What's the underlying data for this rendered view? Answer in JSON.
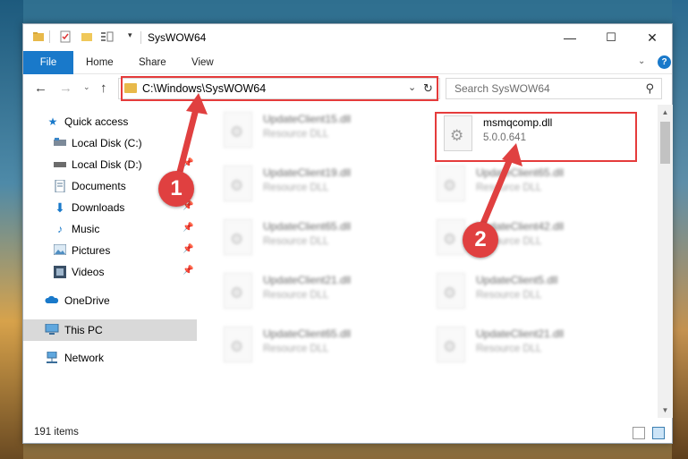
{
  "window": {
    "title": "SysWOW64",
    "controls": {
      "minimize": "—",
      "maximize": "☐",
      "close": "✕"
    }
  },
  "ribbon": {
    "file_tab": "File",
    "tabs": [
      "Home",
      "Share",
      "View"
    ]
  },
  "address_bar": {
    "path": "C:\\Windows\\SysWOW64",
    "search_placeholder": "Search SysWOW64"
  },
  "nav_pane": {
    "items": [
      {
        "label": "Quick access",
        "icon": "star-icon"
      },
      {
        "label": "Local Disk (C:)",
        "icon": "drive-icon"
      },
      {
        "label": "Local Disk (D:)",
        "icon": "drive-icon"
      },
      {
        "label": "Documents",
        "icon": "documents-icon"
      },
      {
        "label": "Downloads",
        "icon": "download-icon"
      },
      {
        "label": "Music",
        "icon": "music-icon"
      },
      {
        "label": "Pictures",
        "icon": "pictures-icon"
      },
      {
        "label": "Videos",
        "icon": "videos-icon"
      },
      {
        "label": "OneDrive",
        "icon": "cloud-icon"
      },
      {
        "label": "This PC",
        "icon": "computer-icon"
      },
      {
        "label": "Network",
        "icon": "network-icon"
      }
    ]
  },
  "files": {
    "highlighted": {
      "name": "msmqcomp.dll",
      "version": "5.0.0.641"
    },
    "left_column": [
      {
        "name": "UpdateClient15.dll",
        "sub": "Resource DLL"
      },
      {
        "name": "UpdateClient19.dll",
        "sub": "Resource DLL"
      },
      {
        "name": "UpdateClient65.dll",
        "sub": "Resource DLL"
      },
      {
        "name": "UpdateClient21.dll",
        "sub": "Resource DLL"
      },
      {
        "name": "UpdateClient65.dll",
        "sub": "Resource DLL"
      }
    ],
    "right_column": [
      {
        "name": "UpdateClient65.dll",
        "sub": "Resource DLL"
      },
      {
        "name": "UpdateClient42.dll",
        "sub": "Resource DLL"
      },
      {
        "name": "UpdateClient5.dll",
        "sub": "Resource DLL"
      },
      {
        "name": "UpdateClient21.dll",
        "sub": "Resource DLL"
      }
    ]
  },
  "status": {
    "item_count": "191 items"
  },
  "callouts": {
    "one": "1",
    "two": "2"
  },
  "colors": {
    "accent": "#1979ca",
    "highlight": "#e53b3b"
  }
}
